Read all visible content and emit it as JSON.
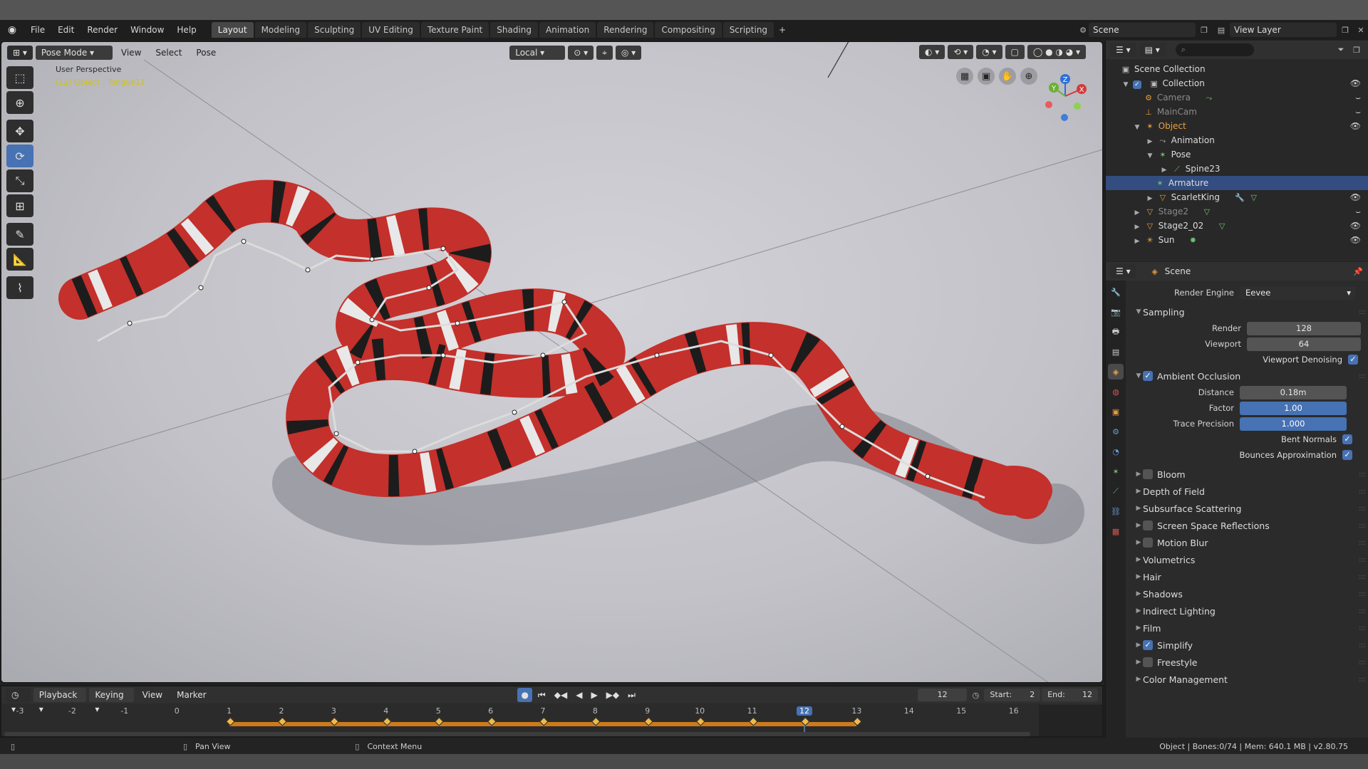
{
  "menubar": {
    "items": [
      "File",
      "Edit",
      "Render",
      "Window",
      "Help"
    ],
    "workspaces": [
      "Layout",
      "Modeling",
      "Sculpting",
      "UV Editing",
      "Texture Paint",
      "Shading",
      "Animation",
      "Rendering",
      "Compositing",
      "Scripting"
    ],
    "active_workspace": "Layout",
    "add_label": "+",
    "scene": "Scene",
    "view_layer": "View Layer"
  },
  "viewport": {
    "mode": "Pose Mode",
    "menus": [
      "View",
      "Select",
      "Pose"
    ],
    "transform_orientation": "Local",
    "perspective_label": "User Perspective",
    "object_label": "(12) Object : Tongue11",
    "gizmo_axes": {
      "x": "X",
      "y": "Y",
      "z": "Z"
    }
  },
  "outliner": {
    "search_placeholder": "",
    "rows": [
      {
        "label": "Scene Collection"
      },
      {
        "label": "Collection"
      },
      {
        "label": "Camera"
      },
      {
        "label": "MainCam"
      },
      {
        "label": "Object"
      },
      {
        "label": "Animation"
      },
      {
        "label": "Pose"
      },
      {
        "label": "Spine23"
      },
      {
        "label": "Armature"
      },
      {
        "label": "ScarletKing"
      },
      {
        "label": "Stage2"
      },
      {
        "label": "Stage2_02"
      },
      {
        "label": "Sun"
      }
    ]
  },
  "properties": {
    "context": "Scene",
    "render_engine_label": "Render Engine",
    "render_engine": "Eevee",
    "sampling": {
      "title": "Sampling",
      "render_label": "Render",
      "render": "128",
      "viewport_label": "Viewport",
      "viewport": "64",
      "denoise_label": "Viewport Denoising"
    },
    "ambient_occlusion": {
      "title": "Ambient Occlusion",
      "distance_label": "Distance",
      "distance": "0.18m",
      "factor_label": "Factor",
      "factor": "1.00",
      "trace_label": "Trace Precision",
      "trace": "1.000",
      "bent_label": "Bent Normals",
      "bounces_label": "Bounces Approximation"
    },
    "sections": {
      "bloom": "Bloom",
      "dof": "Depth of Field",
      "sss": "Subsurface Scattering",
      "ssr": "Screen Space Reflections",
      "motion_blur": "Motion Blur",
      "volumetrics": "Volumetrics",
      "hair": "Hair",
      "shadows": "Shadows",
      "indirect": "Indirect Lighting",
      "film": "Film",
      "simplify": "Simplify",
      "freestyle": "Freestyle",
      "color_mgmt": "Color Management"
    }
  },
  "timeline": {
    "menus": [
      "Playback",
      "Keying",
      "View",
      "Marker"
    ],
    "current_frame": "12",
    "start_label": "Start:",
    "start": "2",
    "end_label": "End:",
    "end": "12",
    "ruler": [
      "-3",
      "-2",
      "-1",
      "0",
      "1",
      "2",
      "3",
      "4",
      "5",
      "6",
      "7",
      "8",
      "9",
      "10",
      "11",
      "12",
      "13",
      "14",
      "15",
      "16"
    ],
    "keyframes": [
      1,
      2,
      3,
      4,
      5,
      6,
      7,
      8,
      9,
      10,
      11,
      12,
      13
    ]
  },
  "statusbar": {
    "pan": "Pan View",
    "context": "Context Menu",
    "stats": "Object | Bones:0/74 | Mem: 640.1 MB | v2.80.75"
  },
  "colors": {
    "accent": "#4772b3",
    "keyframe": "#f0b94a",
    "snake_red": "#c4302b"
  }
}
